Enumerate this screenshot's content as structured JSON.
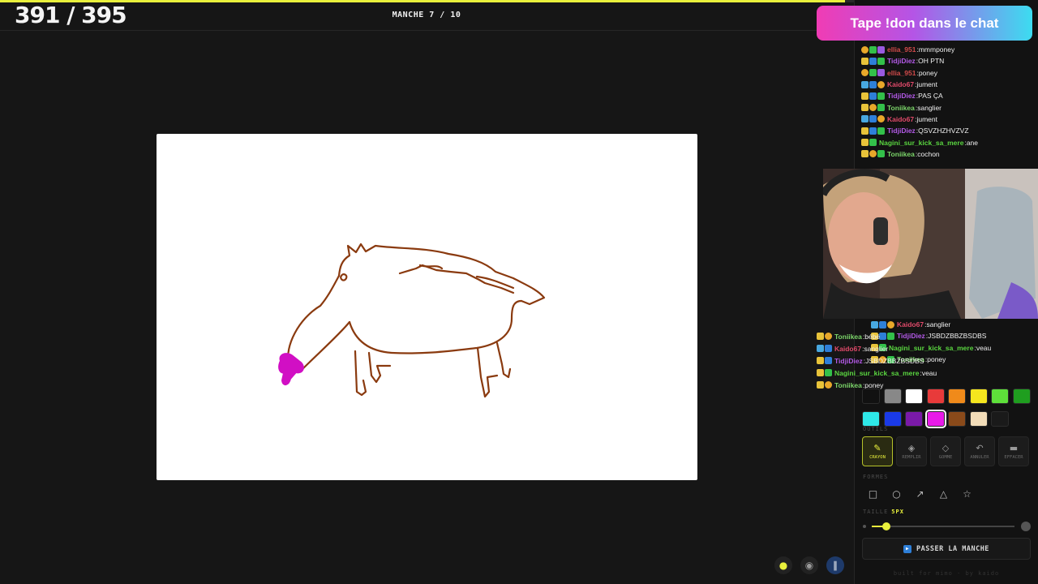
{
  "header": {
    "score": "391 / 395",
    "score_progress": 0.99,
    "round": "MANCHE 7 / 10"
  },
  "banner": {
    "text": "Tape !don dans le chat"
  },
  "chat": [
    {
      "badges": [
        "b-gold",
        "b-green",
        "b-purple"
      ],
      "user": "ellia_951",
      "color": "#d14a4a",
      "message": "mmmponey"
    },
    {
      "badges": [
        "b-crown",
        "b-blue",
        "b-green"
      ],
      "user": "TidjiDiez",
      "color": "#b45ae8",
      "message": "OH PTN"
    },
    {
      "badges": [
        "b-gold",
        "b-green",
        "b-purple"
      ],
      "user": "ellia_951",
      "color": "#d14a4a",
      "message": "poney"
    },
    {
      "badges": [
        "b-sword",
        "b-blue",
        "b-gold"
      ],
      "user": "Kaido67",
      "color": "#e04a6a",
      "message": "jument"
    },
    {
      "badges": [
        "b-crown",
        "b-blue",
        "b-green"
      ],
      "user": "TidjiDiez",
      "color": "#b45ae8",
      "message": "PAS ÇA"
    },
    {
      "badges": [
        "b-crown",
        "b-gold",
        "b-green"
      ],
      "user": "Toniikea",
      "color": "#7cd66a",
      "message": "sanglier"
    },
    {
      "badges": [
        "b-sword",
        "b-blue",
        "b-gold"
      ],
      "user": "Kaido67",
      "color": "#e04a6a",
      "message": "jument"
    },
    {
      "badges": [
        "b-crown",
        "b-blue",
        "b-green"
      ],
      "user": "TidjiDiez",
      "color": "#b45ae8",
      "message": "QSVZHZHVZVZ"
    },
    {
      "badges": [
        "b-crown",
        "b-green"
      ],
      "user": "Nagini_sur_kick_sa_mere",
      "color": "#5ad640",
      "message": "ane"
    },
    {
      "badges": [
        "b-crown",
        "b-gold",
        "b-green"
      ],
      "user": "Toniikea",
      "color": "#7cd66a",
      "message": "cochon"
    }
  ],
  "chat_after_cam": [
    {
      "badges": [
        "b-sword",
        "b-blue",
        "b-gold"
      ],
      "user": "Kaido67",
      "color": "#e04a6a",
      "message": "sanglier"
    },
    {
      "badges": [
        "b-crown",
        "b-blue",
        "b-green"
      ],
      "user": "TidjiDiez",
      "color": "#b45ae8",
      "message": "JSBDZBBZBSDBS"
    },
    {
      "badges": [
        "b-crown",
        "b-green"
      ],
      "user": "Nagini_sur_kick_sa_mere",
      "color": "#5ad640",
      "message": "veau"
    },
    {
      "badges": [
        "b-crown",
        "b-gold",
        "b-green"
      ],
      "user": "Toniikea",
      "color": "#7cd66a",
      "message": "poney"
    }
  ],
  "overlay_chat": [
    {
      "badges": [
        "b-crown",
        "b-gold"
      ],
      "user": "Toniikea",
      "color": "#7cd66a",
      "message": "bébé"
    },
    {
      "badges": [
        "b-sword",
        "b-blue"
      ],
      "user": "Kaido67",
      "color": "#e04a6a",
      "message": "sanglier"
    },
    {
      "badges": [
        "b-crown",
        "b-blue"
      ],
      "user": "TidjiDiez",
      "color": "#b45ae8",
      "message": "JSBDZBBZBSDBS"
    },
    {
      "badges": [
        "b-crown",
        "b-green"
      ],
      "user": "Nagini_sur_kick_sa_mere",
      "color": "#5ad640",
      "message": "veau"
    },
    {
      "badges": [
        "b-crown",
        "b-gold"
      ],
      "user": "Toniikea",
      "color": "#7cd66a",
      "message": "poney"
    }
  ],
  "palette": {
    "colors": [
      "#111111",
      "#888888",
      "#ffffff",
      "#e83a3a",
      "#f08a1a",
      "#f5e61e",
      "#5ee03a",
      "#1f9e1f",
      "#2ee8e8",
      "#1a3ae8",
      "#7a1aa8",
      "#e81ae8",
      "#8a4a1a",
      "#f2dcb8",
      "#1a1a1a"
    ],
    "selected": 11
  },
  "tools": {
    "label": "OUTILS",
    "items": [
      {
        "icon": "pencil-icon",
        "glyph": "✎",
        "label": "CRAYON",
        "active": true
      },
      {
        "icon": "fill-bucket-icon",
        "glyph": "◈",
        "label": "REMPLIR",
        "active": false
      },
      {
        "icon": "eraser-icon",
        "glyph": "◇",
        "label": "GOMME",
        "active": false
      },
      {
        "icon": "undo-icon",
        "glyph": "↶",
        "label": "ANNULER",
        "active": false
      },
      {
        "icon": "trash-icon",
        "glyph": "▬",
        "label": "EFFACER",
        "active": false
      }
    ]
  },
  "shapes": {
    "label": "FORMES",
    "items": [
      {
        "icon": "rectangle-icon",
        "glyph": "□"
      },
      {
        "icon": "ellipse-icon",
        "glyph": "○"
      },
      {
        "icon": "arrow-icon",
        "glyph": "↗"
      },
      {
        "icon": "triangle-icon",
        "glyph": "△"
      },
      {
        "icon": "star-icon",
        "glyph": "☆"
      }
    ]
  },
  "brush": {
    "label": "TAILLE",
    "value": "5PX",
    "level": 0.1
  },
  "skip_button": {
    "label": "PASSER LA MANCHE"
  },
  "footer": "built for mimo · by kaido",
  "drawing": {
    "stroke_color": "#8a3a0f",
    "accent_color": "#d10fc4"
  }
}
